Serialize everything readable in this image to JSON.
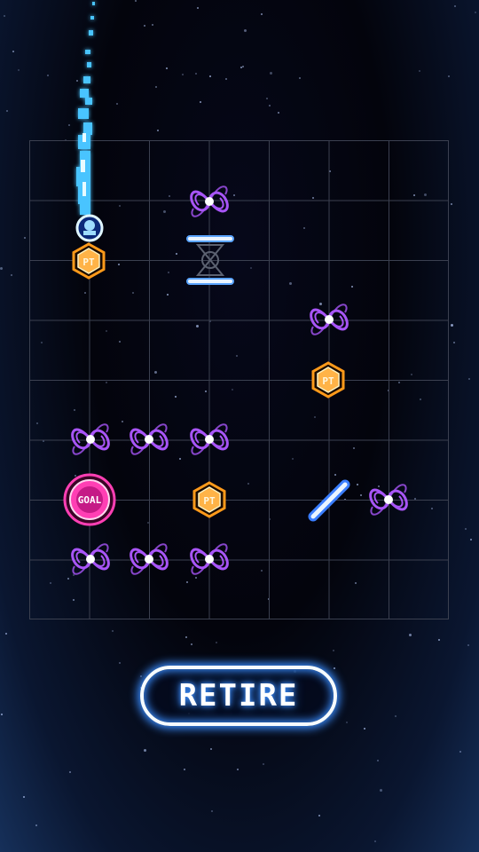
{
  "board": {
    "rows": 8,
    "columns": 7
  },
  "labels": {
    "point": "PT",
    "goal": "GOAL"
  },
  "buttons": {
    "retire_label": "RETIRE"
  },
  "colors": {
    "warp": "#a855f7",
    "point": "#ff9a1a",
    "goal": "#ff3fb4",
    "trail": "#48c4ff",
    "button_glow": "#3a8dff"
  },
  "icons": [
    "warp-hole-icon",
    "point-coin-icon",
    "goal-icon",
    "player-ship-icon",
    "barrier-gate-icon",
    "diagonal-reflector-icon"
  ]
}
